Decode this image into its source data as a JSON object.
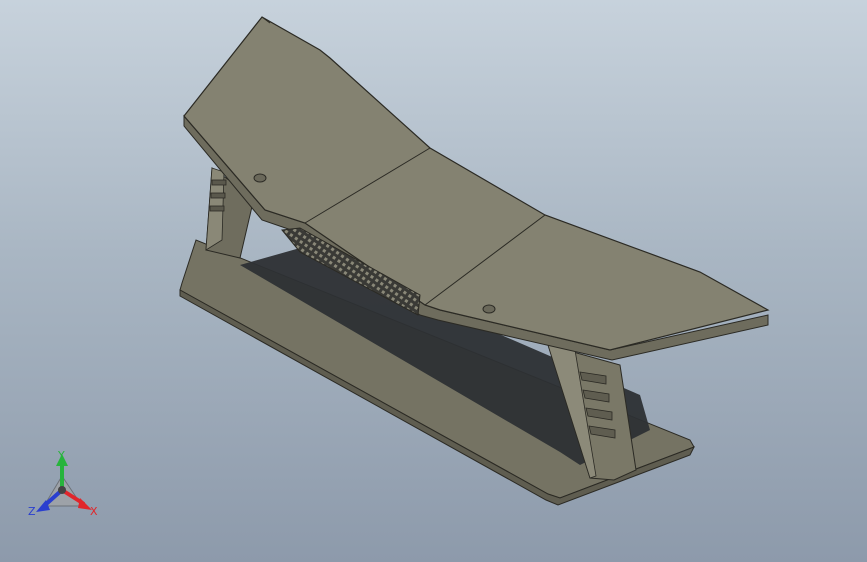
{
  "view": {
    "background_top": "#c7d2dc",
    "background_bottom": "#8d9aab"
  },
  "model": {
    "body_color": "#7d7b6a",
    "top_color": "#848271",
    "edge_color": "#2b2a24",
    "shadow_color": "#2d3034"
  },
  "triad": {
    "x_label": "X",
    "y_label": "Y",
    "z_label": "Z",
    "x_color": "#e0262b",
    "y_color": "#27b43c",
    "z_color": "#2a3fcf"
  }
}
